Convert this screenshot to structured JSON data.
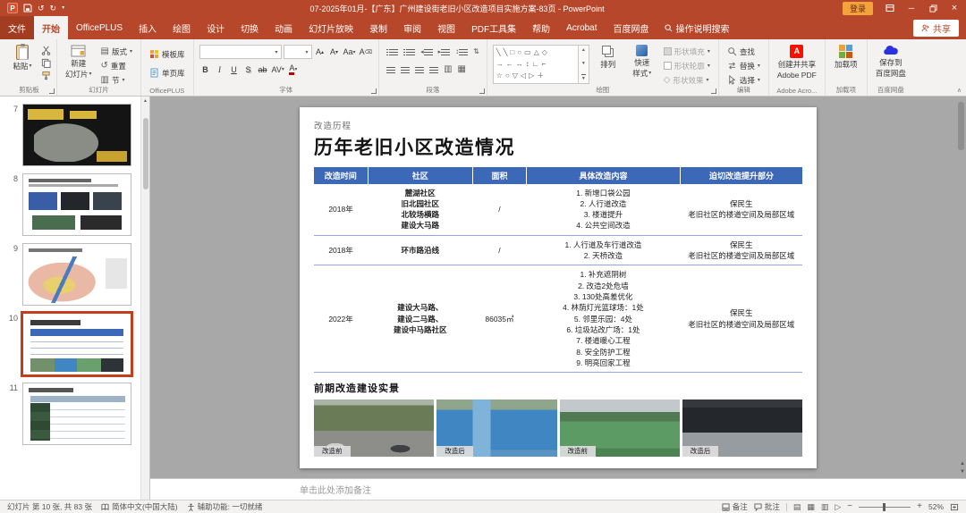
{
  "titlebar": {
    "title": "07-2025年01月-【广东】广州建设街老旧小区改造项目实施方案-83页 - PowerPoint",
    "login_label": "登录"
  },
  "ribbon": {
    "tabs": [
      "文件",
      "开始",
      "OfficePLUS",
      "插入",
      "绘图",
      "设计",
      "切换",
      "动画",
      "幻灯片放映",
      "录制",
      "审阅",
      "视图",
      "PDF工具集",
      "帮助",
      "Acrobat",
      "百度网盘"
    ],
    "tell_me": "操作说明搜索",
    "share_label": "共享",
    "clipboard": {
      "paste": "粘贴",
      "label": "剪贴板"
    },
    "slides": {
      "new_slide_line1": "新建",
      "new_slide_line2": "幻灯片",
      "layout": "版式",
      "reset": "重置",
      "section": "节",
      "label": "幻灯片"
    },
    "officeplus": {
      "template_btn": "模板库",
      "single_page_btn": "单页库",
      "label": "OfficePLUS"
    },
    "font": {
      "label": "字体"
    },
    "paragraph": {
      "label": "段落"
    },
    "drawing": {
      "arrange": "排列",
      "quick_styles_line1": "快速",
      "quick_styles_line2": "样式",
      "shape_fill": "形状填充",
      "shape_outline": "形状轮廓",
      "shape_effects": "形状效果",
      "label": "绘图"
    },
    "editing": {
      "find": "查找",
      "replace": "替换",
      "select": "选择",
      "label": "编辑"
    },
    "adobe": {
      "line1": "创建并共享",
      "line2": "Adobe PDF",
      "label": "Adobe Acro..."
    },
    "addins": {
      "btn": "加载项",
      "label": "加载项"
    },
    "baidu": {
      "line1": "保存到",
      "line2": "百度网盘",
      "label": "百度网盘"
    }
  },
  "sidebar": {
    "thumbnails": [
      {
        "number": "7"
      },
      {
        "number": "8"
      },
      {
        "number": "9"
      },
      {
        "number": "10"
      },
      {
        "number": "11"
      }
    ]
  },
  "slide": {
    "kicker": "改造历程",
    "title": "历年老旧小区改造情况",
    "table": {
      "headers": [
        "改造时间",
        "社区",
        "面积",
        "具体改造内容",
        "迫切改造提升部分"
      ],
      "rows": [
        {
          "time": "2018年",
          "community": "麓湖社区\n旧北园社区\n北较场横路\n建设大马路",
          "area": "/",
          "content": "1. 新增口袋公园\n2. 人行道改造\n3. 楼道提升\n4. 公共空间改造",
          "upgrade": "保民生\n老旧社区的楼道空间及局部区域"
        },
        {
          "time": "2018年",
          "community": "环市路沿线",
          "area": "/",
          "content": "1. 人行道及车行道改造\n2. 天桥改造",
          "upgrade": "保民生\n老旧社区的楼道空间及局部区域"
        },
        {
          "time": "2022年",
          "community": "建设大马路、\n建设二马路、\n建设中马路社区",
          "area": "86035㎡",
          "content": "1. 补充遮阴树\n2. 改造2处危墙\n3. 130处高差优化\n4. 林荫灯光篮球场：1处\n5. 邻里乐园：4处\n6. 垃圾站改广场：1处\n7. 楼道暖心工程\n8. 安全防护工程\n9. 明亮回家工程",
          "upgrade": "保民生\n老旧社区的楼道空间及局部区域"
        }
      ]
    },
    "photos_title": "前期改造建设实景",
    "photos": [
      {
        "label": "改造前"
      },
      {
        "label": "改造后"
      },
      {
        "label": "改造前"
      },
      {
        "label": "改造后"
      }
    ]
  },
  "notes_pane": {
    "placeholder": "单击此处添加备注"
  },
  "statusbar": {
    "slide_indicator": "幻灯片 第 10 张, 共 83 张",
    "language": "简体中文(中国大陆)",
    "accessibility": "辅助功能: 一切就绪",
    "notes_label": "备注",
    "comments_label": "批注",
    "zoom_level": "52%"
  },
  "colors": {
    "brand_red": "#B7472A",
    "table_header_blue": "#3C68B8",
    "selection_red": "#C43E1C"
  }
}
